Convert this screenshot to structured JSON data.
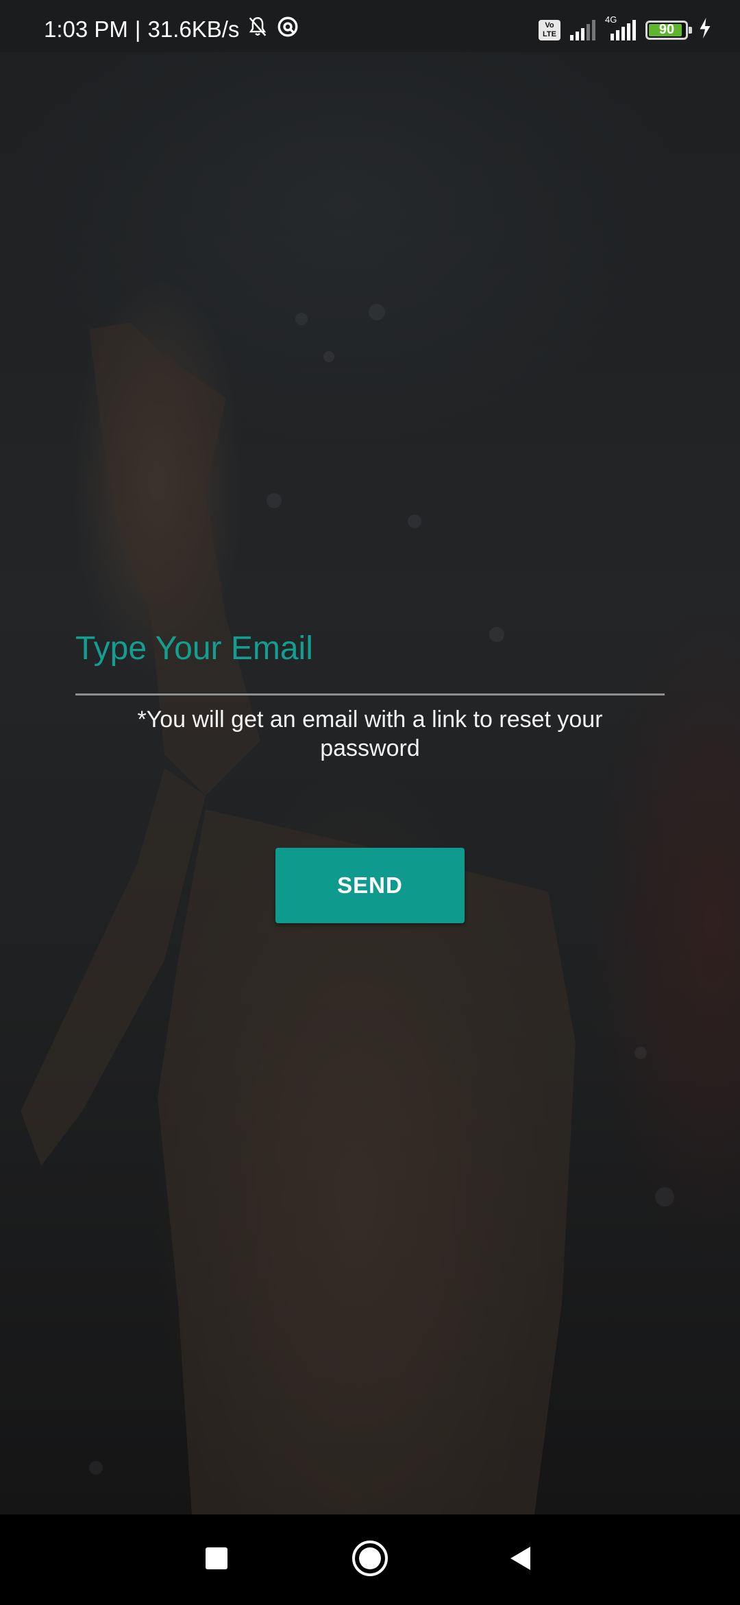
{
  "status_bar": {
    "time": "1:03 PM",
    "separator": "|",
    "network_speed": "31.6KB/s",
    "volte_label": "Vo LTE",
    "network_type": "4G",
    "battery_level": "90",
    "icons": [
      "mute-bell-icon",
      "data-saver-icon",
      "volte-icon",
      "signal-icon",
      "signal-4g-icon",
      "battery-icon",
      "charging-icon"
    ]
  },
  "form": {
    "email_placeholder": "Type Your Email",
    "email_value": "",
    "hint": "*You will get an email with a link to reset your password",
    "send_label": "SEND"
  },
  "nav_bar": {
    "icons": [
      "recents-square-icon",
      "home-circle-icon",
      "back-triangle-icon"
    ]
  },
  "colors": {
    "accent": "#0e9a8c",
    "placeholder": "#149e92",
    "background": "#1e1f20"
  }
}
